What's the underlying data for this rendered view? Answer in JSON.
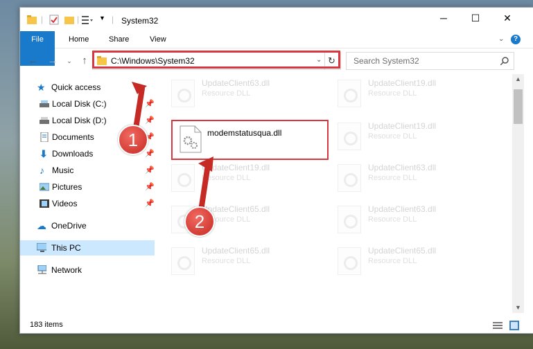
{
  "window": {
    "title": "System32",
    "controls": {
      "minimize": "─",
      "maximize": "☐",
      "close": "✕"
    }
  },
  "ribbon": {
    "tabs": [
      "File",
      "Home",
      "Share",
      "View"
    ],
    "help_icon": "?"
  },
  "address": {
    "path": "C:\\Windows\\System32",
    "search_placeholder": "Search System32"
  },
  "nav": {
    "quick_access": "Quick access",
    "items": [
      {
        "label": "Local Disk (C:)",
        "icon": "drive-icon"
      },
      {
        "label": "Local Disk (D:)",
        "icon": "drive-icon"
      },
      {
        "label": "Documents",
        "icon": "documents-icon"
      },
      {
        "label": "Downloads",
        "icon": "downloads-icon"
      },
      {
        "label": "Music",
        "icon": "music-icon"
      },
      {
        "label": "Pictures",
        "icon": "pictures-icon"
      },
      {
        "label": "Videos",
        "icon": "videos-icon"
      }
    ],
    "onedrive": "OneDrive",
    "this_pc": "This PC",
    "network": "Network"
  },
  "files": {
    "highlighted": {
      "name": "modemstatusqua.dll"
    },
    "left_column": [
      {
        "name": "UpdateClient63.dll",
        "type": "Resource DLL"
      },
      {
        "name": "UpdateClient19.dll",
        "type": "Resource DLL"
      },
      {
        "name": "UpdateClient65.dll",
        "type": "Resource DLL"
      },
      {
        "name": "UpdateClient65.dll",
        "type": "Resource DLL"
      }
    ],
    "right_column": [
      {
        "name": "UpdateClient19.dll",
        "type": "Resource DLL"
      },
      {
        "name": "UpdateClient19.dll",
        "type": "Resource DLL"
      },
      {
        "name": "UpdateClient63.dll",
        "type": "Resource DLL"
      },
      {
        "name": "UpdateClient63.dll",
        "type": "Resource DLL"
      },
      {
        "name": "UpdateClient65.dll",
        "type": "Resource DLL"
      }
    ]
  },
  "status": {
    "item_count": "183 items"
  },
  "annotations": {
    "step1": "1",
    "step2": "2"
  },
  "colors": {
    "accent": "#1979ca",
    "highlight": "#d9363e",
    "selected": "#cce8ff"
  }
}
